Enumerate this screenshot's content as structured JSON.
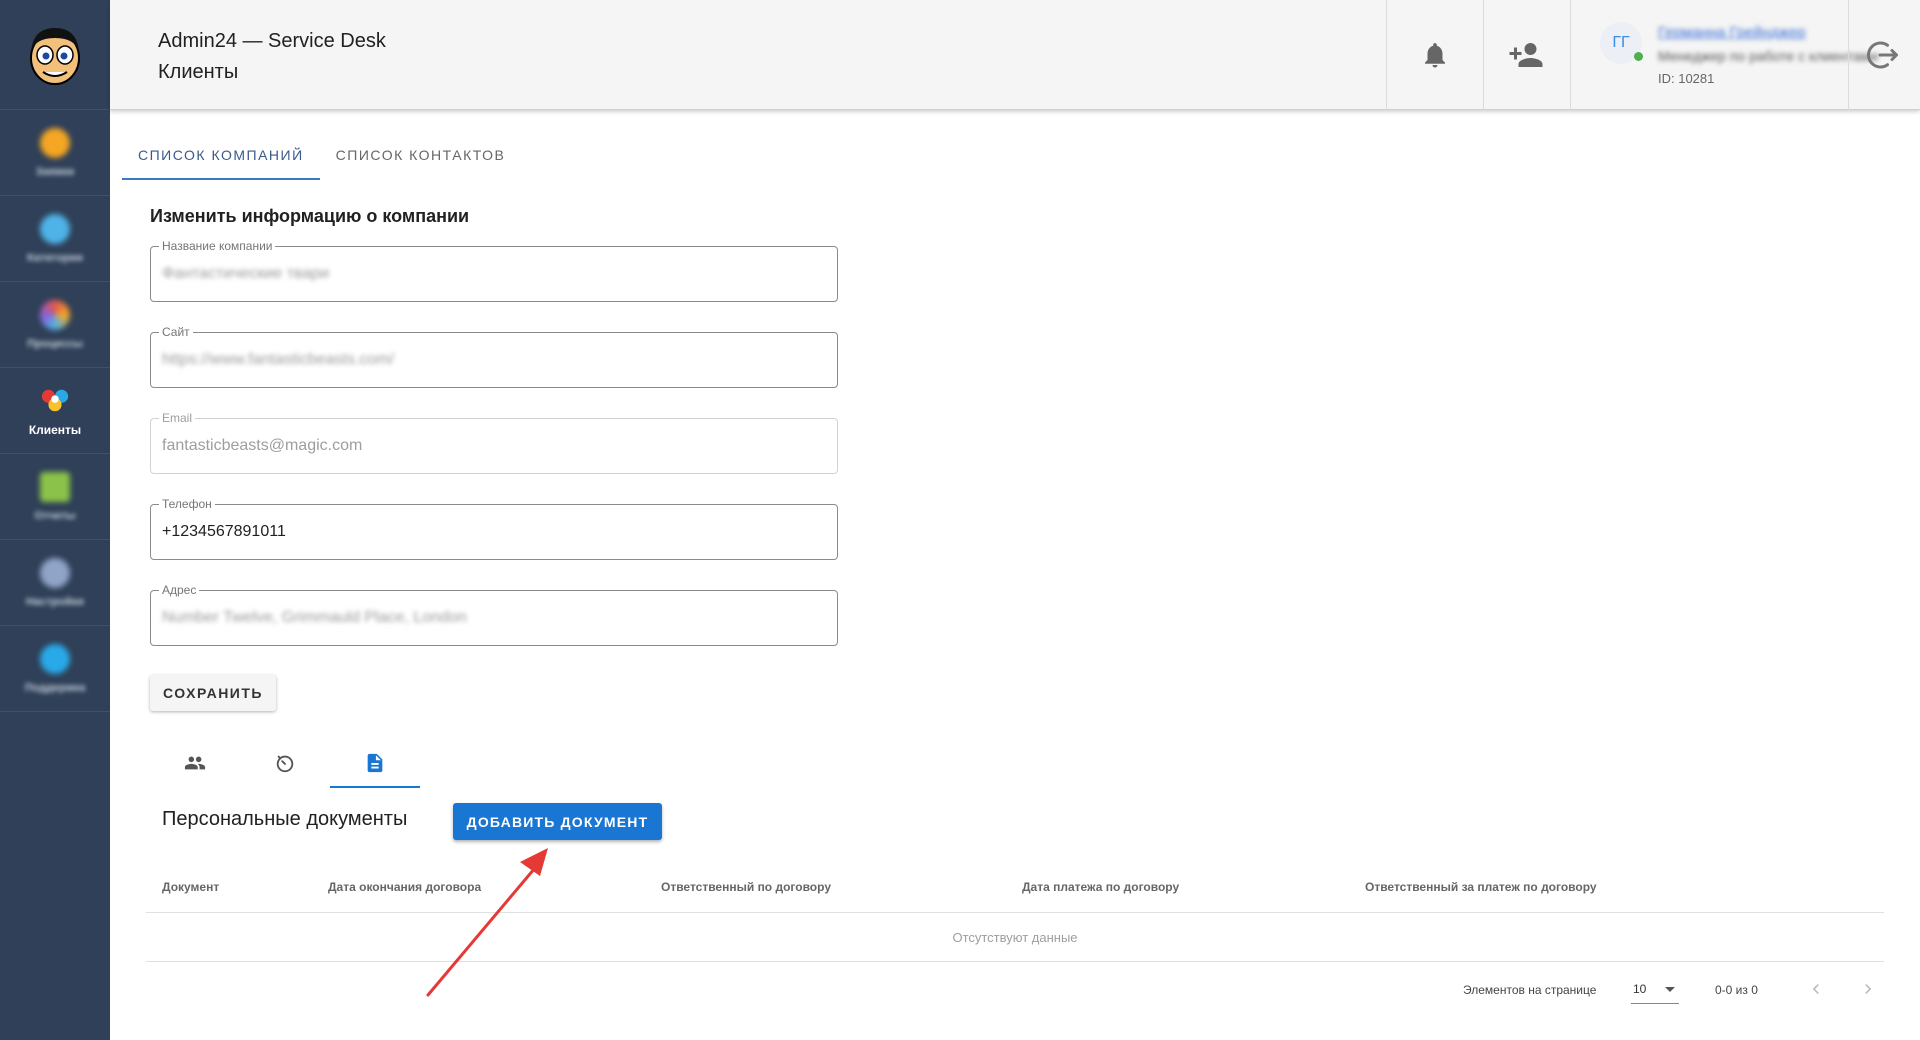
{
  "header": {
    "app_title": "Admin24 — Service Desk",
    "page_title": "Клиенты",
    "user": {
      "initials": "ГГ",
      "name": "Германна Грейнджер",
      "role": "Менеджер по работе с клиентами",
      "id_text": "ID: 10281"
    },
    "icons": {
      "notifications": "bell-icon",
      "add_user": "person-add-icon",
      "logout": "logout-icon"
    }
  },
  "sidebar": {
    "items": [
      {
        "label": "Заявки",
        "icon": "tickets-icon",
        "color": "#f5a623"
      },
      {
        "label": "Категории",
        "icon": "categories-icon",
        "color": "#4fb3e8"
      },
      {
        "label": "Процессы",
        "icon": "processes-icon",
        "color": "#e0584f"
      },
      {
        "label": "Клиенты",
        "icon": "clients-icon",
        "color": "#e53935",
        "active": true
      },
      {
        "label": "Отчеты",
        "icon": "reports-icon",
        "color": "#8bc34a"
      },
      {
        "label": "Настройки",
        "icon": "settings-icon",
        "color": "#90a4c8"
      },
      {
        "label": "Поддержка",
        "icon": "support-icon",
        "color": "#29a9e8"
      }
    ]
  },
  "tabs": [
    {
      "label": "СПИСОК КОМПАНИЙ",
      "active": true
    },
    {
      "label": "СПИСОК КОНТАКТОВ",
      "active": false
    }
  ],
  "form": {
    "title": "Изменить информацию о компании",
    "fields": [
      {
        "label": "Название компании",
        "value": "Фантастические твари"
      },
      {
        "label": "Сайт",
        "value": "https://www.fantasticbeasts.com/"
      },
      {
        "label": "Email",
        "value": "fantasticbeasts@magic.com"
      },
      {
        "label": "Телефон",
        "value": "+1234567891011"
      },
      {
        "label": "Адрес",
        "value": "Number Twelve, Grimmauld Place, London"
      }
    ],
    "save_label": "СОХРАНИТЬ"
  },
  "sub_tabs": [
    {
      "icon": "people-icon",
      "active": false
    },
    {
      "icon": "history-icon",
      "active": false
    },
    {
      "icon": "document-icon",
      "active": true
    }
  ],
  "documents": {
    "title": "Персональные документы",
    "add_label": "ДОБАВИТЬ ДОКУМЕНТ",
    "columns": [
      "Документ",
      "Дата окончания договора",
      "Ответственный по договору",
      "Дата платежа по договору",
      "Ответственный за платеж по договору"
    ],
    "empty_text": "Отсутствуют данные"
  },
  "pagination": {
    "per_page_label": "Элементов на странице",
    "per_page_value": "10",
    "range_text": "0-0 из 0"
  },
  "colors": {
    "sidebar_bg": "#2f4058",
    "primary": "#1976d2",
    "annotation_arrow": "#e53935"
  }
}
